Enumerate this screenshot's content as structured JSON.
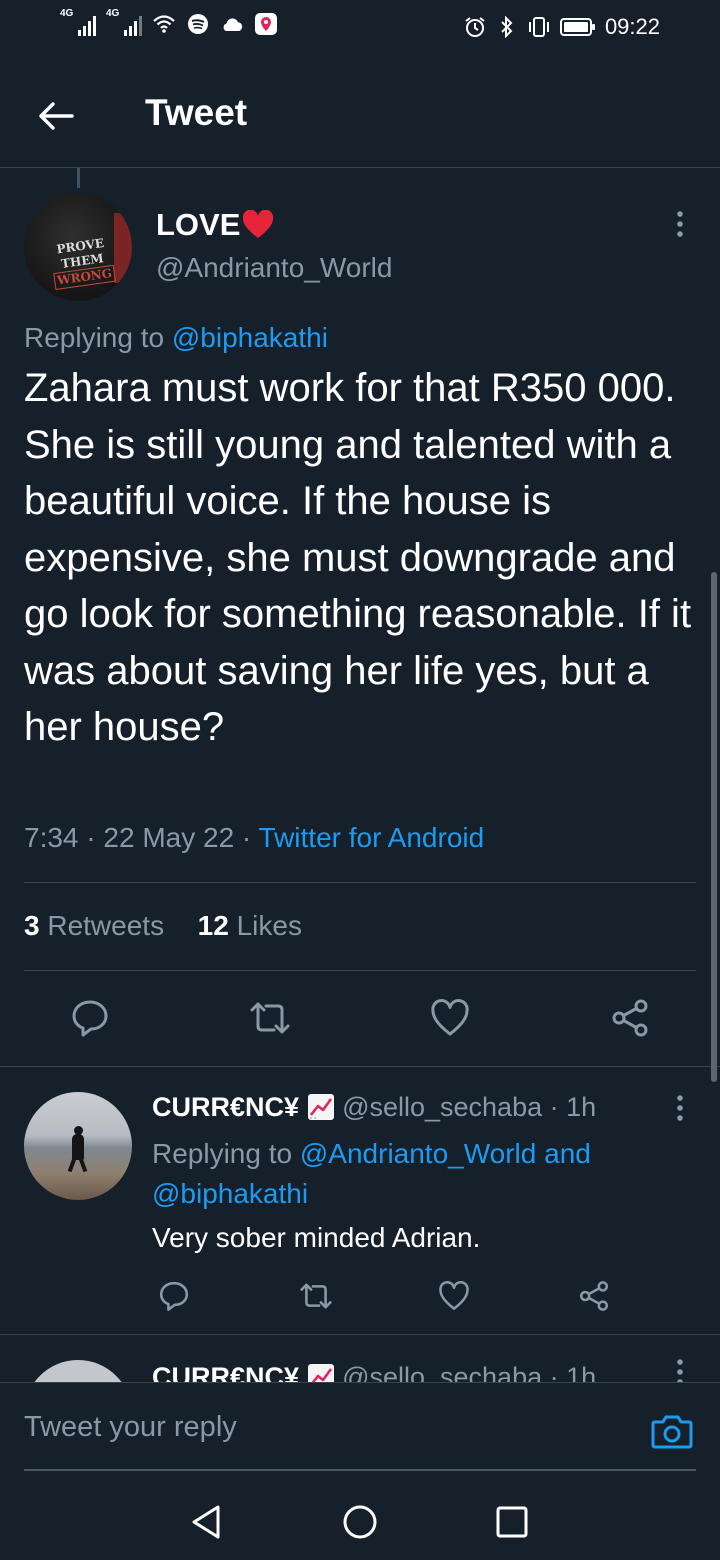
{
  "status_bar": {
    "network_1": "4G",
    "network_2": "4G",
    "time": "09:22",
    "icons": [
      "signal-icon",
      "wifi-icon",
      "spotify-icon",
      "cloud-icon",
      "location-app-icon",
      "alarm-icon",
      "bluetooth-icon",
      "vibrate-icon",
      "battery-icon"
    ]
  },
  "header": {
    "title": "Tweet"
  },
  "main_tweet": {
    "author_name": "LOVE",
    "author_handle": "@Andrianto_World",
    "avatar_text": [
      "PROVE",
      "THEM",
      "WRONG"
    ],
    "replying_prefix": "Replying to",
    "replying_to": "@biphakathi",
    "text": "Zahara must work for that R350 000. She is still young and talented with a beautiful voice. If the house is expensive, she must downgrade and go look for something reasonable. If it was about saving her life yes, but a her house?",
    "time": "7:34",
    "date": "22 May 22",
    "source": "Twitter for Android",
    "retweets_count": "3",
    "retweets_label": "Retweets",
    "likes_count": "12",
    "likes_label": "Likes"
  },
  "reply_tweet": {
    "author_name": "CURR€NC¥",
    "author_handle": "@sello_sechaba",
    "age": "1h",
    "replying_prefix": "Replying to",
    "replying_to": "@Andrianto_World and @biphakathi",
    "text": "Very sober minded Adrian."
  },
  "next_reply": {
    "author_name": "CURR€NC¥",
    "author_handle": "@sello_sechaba",
    "age": "1h"
  },
  "composer": {
    "placeholder": "Tweet your reply"
  },
  "colors": {
    "background": "#15202b",
    "accent": "#1d9bf0",
    "secondary_text": "#8b98a5",
    "divider": "#38444d",
    "heart": "#f91880"
  }
}
